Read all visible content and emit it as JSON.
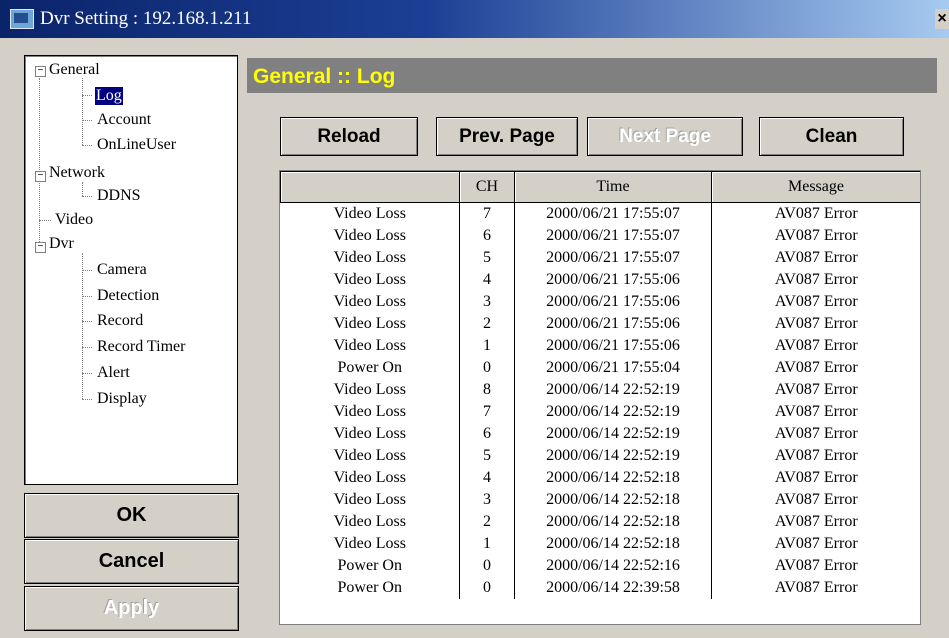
{
  "window": {
    "title": "Dvr Setting : 192.168.1.211",
    "close": "×"
  },
  "tree": {
    "general": "General",
    "log": "Log",
    "account": "Account",
    "onlineuser": "OnLineUser",
    "network": "Network",
    "ddns": "DDNS",
    "video": "Video",
    "dvr": "Dvr",
    "camera": "Camera",
    "detection": "Detection",
    "record": "Record",
    "record_timer": "Record Timer",
    "alert": "Alert",
    "display": "Display"
  },
  "buttons": {
    "ok": "OK",
    "cancel": "Cancel",
    "apply": "Apply"
  },
  "panel": {
    "title": "General :: Log"
  },
  "toolbar": {
    "reload": "Reload",
    "prev": "Prev. Page",
    "next": "Next Page",
    "clean": "Clean"
  },
  "table": {
    "columns": [
      "",
      "CH",
      "Time",
      "Message"
    ],
    "rows": [
      [
        "Video Loss",
        "7",
        "2000/06/21 17:55:07",
        "AV087 Error"
      ],
      [
        "Video Loss",
        "6",
        "2000/06/21 17:55:07",
        "AV087 Error"
      ],
      [
        "Video Loss",
        "5",
        "2000/06/21 17:55:07",
        "AV087 Error"
      ],
      [
        "Video Loss",
        "4",
        "2000/06/21 17:55:06",
        "AV087 Error"
      ],
      [
        "Video Loss",
        "3",
        "2000/06/21 17:55:06",
        "AV087 Error"
      ],
      [
        "Video Loss",
        "2",
        "2000/06/21 17:55:06",
        "AV087 Error"
      ],
      [
        "Video Loss",
        "1",
        "2000/06/21 17:55:06",
        "AV087 Error"
      ],
      [
        "Power On",
        "0",
        "2000/06/21 17:55:04",
        "AV087 Error"
      ],
      [
        "Video Loss",
        "8",
        "2000/06/14 22:52:19",
        "AV087 Error"
      ],
      [
        "Video Loss",
        "7",
        "2000/06/14 22:52:19",
        "AV087 Error"
      ],
      [
        "Video Loss",
        "6",
        "2000/06/14 22:52:19",
        "AV087 Error"
      ],
      [
        "Video Loss",
        "5",
        "2000/06/14 22:52:19",
        "AV087 Error"
      ],
      [
        "Video Loss",
        "4",
        "2000/06/14 22:52:18",
        "AV087 Error"
      ],
      [
        "Video Loss",
        "3",
        "2000/06/14 22:52:18",
        "AV087 Error"
      ],
      [
        "Video Loss",
        "2",
        "2000/06/14 22:52:18",
        "AV087 Error"
      ],
      [
        "Video Loss",
        "1",
        "2000/06/14 22:52:18",
        "AV087 Error"
      ],
      [
        "Power On",
        "0",
        "2000/06/14 22:52:16",
        "AV087 Error"
      ],
      [
        "Power On",
        "0",
        "2000/06/14 22:39:58",
        "AV087 Error"
      ]
    ]
  },
  "colors": {
    "title_bg": "#0a246a",
    "panel_bg": "#808080",
    "panel_title": "#ffff00",
    "selected": "#000080"
  },
  "icons": {
    "window": "dvr-window-icon",
    "close": "close-icon",
    "collapse": "minus-box-icon"
  }
}
